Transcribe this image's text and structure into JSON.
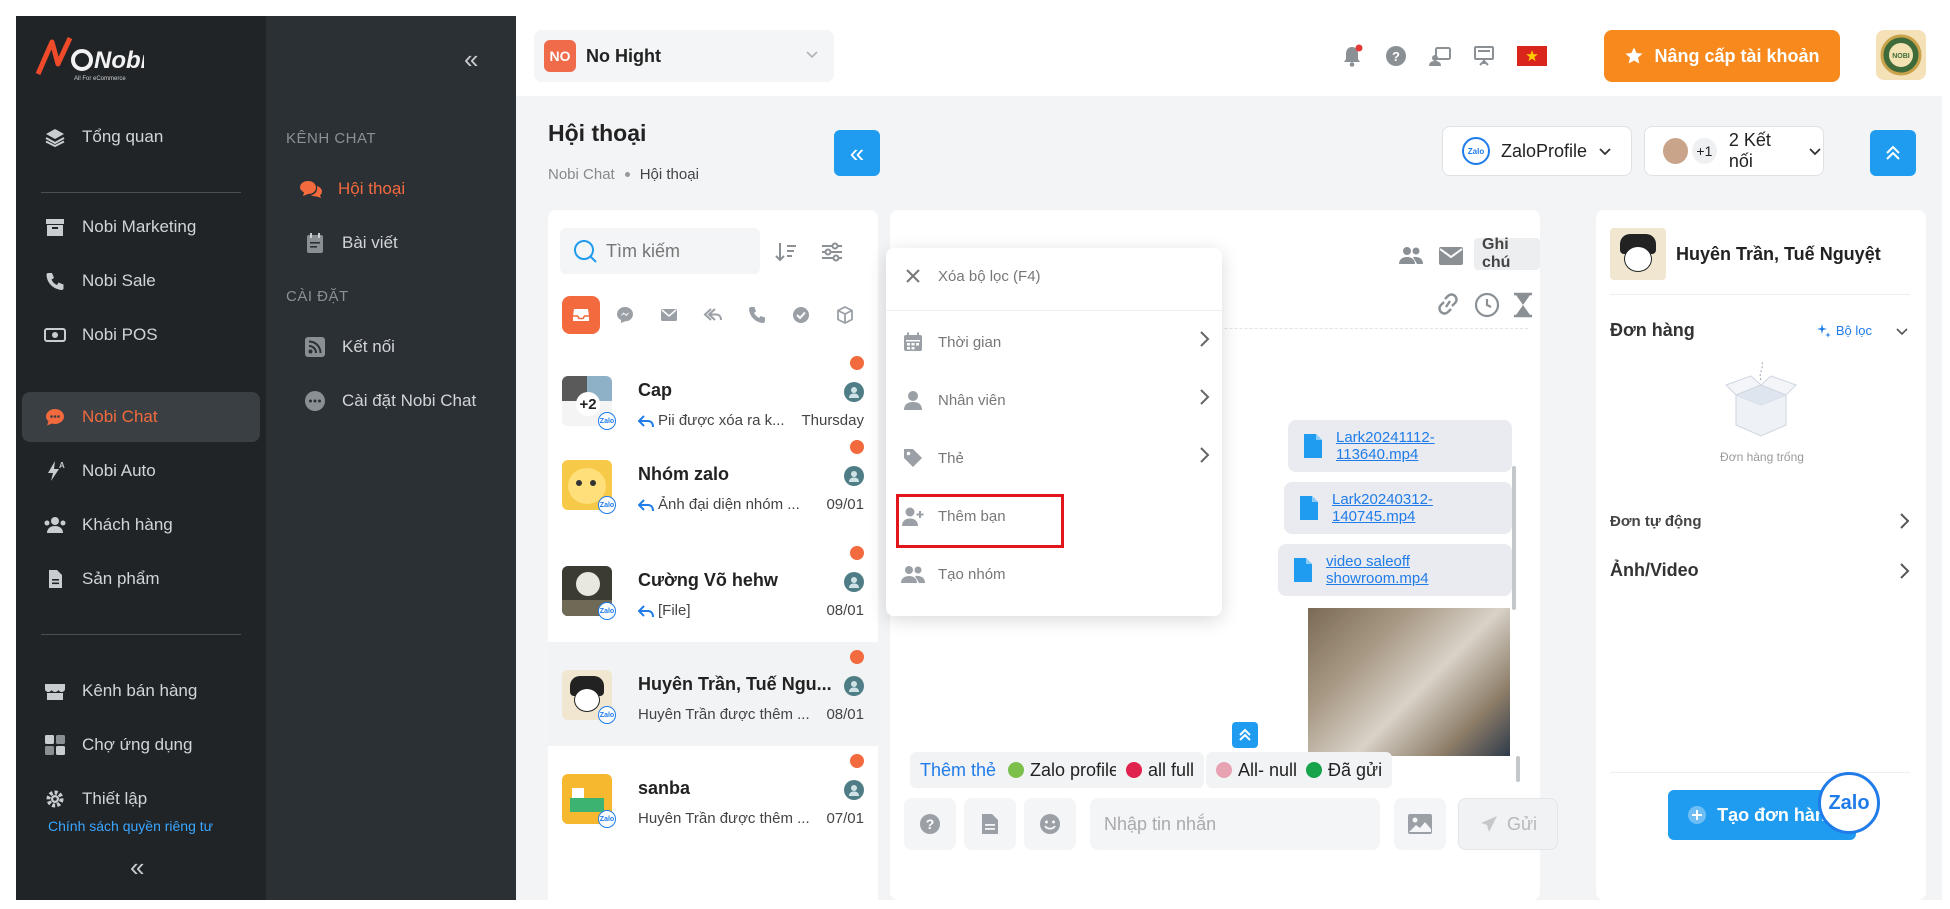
{
  "sidebar": {
    "brand_text": "Nobi",
    "tagline": "All For eCommerce",
    "items": [
      {
        "label": "Tổng quan",
        "icon": "layers-icon"
      },
      {
        "label": "Nobi Marketing",
        "icon": "archive-icon"
      },
      {
        "label": "Nobi Sale",
        "icon": "phone-call-icon"
      },
      {
        "label": "Nobi POS",
        "icon": "cash-icon"
      },
      {
        "label": "Nobi Chat",
        "icon": "chat-bubble-icon"
      },
      {
        "label": "Nobi Auto",
        "icon": "lightning-auto-icon"
      },
      {
        "label": "Khách hàng",
        "icon": "users-icon"
      },
      {
        "label": "Sản phẩm",
        "icon": "document-icon"
      },
      {
        "label": "Kênh bán hàng",
        "icon": "storefront-icon"
      },
      {
        "label": "Chợ ứng dụng",
        "icon": "app-grid-icon"
      },
      {
        "label": "Thiết lập",
        "icon": "gear-icon"
      }
    ],
    "policy_link": "Chính sách quyền riêng tư",
    "collapse_symbol": "«"
  },
  "subnav": {
    "collapse_symbol": "«",
    "sections": [
      {
        "title": "KÊNH CHAT",
        "items": [
          {
            "label": "Hội thoại"
          },
          {
            "label": "Bài viết"
          }
        ]
      },
      {
        "title": "CÀI ĐẶT",
        "items": [
          {
            "label": "Kết nối"
          },
          {
            "label": "Cài đặt Nobi Chat"
          }
        ]
      }
    ]
  },
  "topbar": {
    "shop_badge": "NO",
    "shop_name": "No Hight",
    "upgrade_label": "Nâng cấp tài khoản",
    "avatar_text": "NOBI"
  },
  "page": {
    "title": "Hội thoại",
    "breadcrumb": [
      "Nobi Chat",
      "Hội thoại"
    ],
    "collapse_symbol": "«",
    "channel_select": "ZaloProfile",
    "zalo_logo_text": "Zalo",
    "connections": {
      "extra": "+1",
      "label": "2 Kết nối"
    },
    "expand_symbol": "⌃"
  },
  "conversations": {
    "search_placeholder": "Tìm kiếm",
    "items": [
      {
        "name": "Cap",
        "message": "Pii được xóa ra k...",
        "time": "Thursday",
        "avatar_text": "+2",
        "replied": true
      },
      {
        "name": "Nhóm zalo",
        "message": "Ảnh đại diện nhóm ...",
        "time": "09/01",
        "avatar_text": "",
        "replied": true
      },
      {
        "name": "Cường Võ hehw",
        "message": "[File]",
        "time": "08/01",
        "avatar_text": "",
        "replied": true
      },
      {
        "name": "Huyên Trần, Tuế Ngu...",
        "message": "Huyên Trần được thêm ...",
        "time": "08/01",
        "avatar_text": "",
        "replied": false
      },
      {
        "name": "sanba",
        "message": "Huyên Trần được thêm ...",
        "time": "07/01",
        "avatar_text": "",
        "replied": false
      }
    ],
    "zalo_mini": "Zalo"
  },
  "chat": {
    "note_label": "Ghi chú",
    "files": [
      {
        "name": "Lark20241112-113640.mp4"
      },
      {
        "name": "Lark20240312-140745.mp4"
      },
      {
        "name": "video saleoff showroom.mp4"
      }
    ],
    "tags": [
      {
        "label": "Thêm thẻ",
        "color": ""
      },
      {
        "label": "Zalo profile",
        "color": "#7cc04b"
      },
      {
        "label": "all full",
        "color": "#e0234e"
      },
      {
        "label": "All- null",
        "color": "#e8a3b3"
      },
      {
        "label": "Đã gửi",
        "color": "#16a34a"
      }
    ],
    "input_placeholder": "Nhập tin nhắn",
    "send_label": "Gửi",
    "scroll_up_symbol": "⌃"
  },
  "filter_menu": {
    "items": [
      {
        "label": "Xóa bộ lọc (F4)",
        "icon": "close-icon",
        "has_arrow": false
      },
      {
        "label": "Thời gian",
        "icon": "calendar-icon",
        "has_arrow": true
      },
      {
        "label": "Nhân viên",
        "icon": "person-icon",
        "has_arrow": true
      },
      {
        "label": "Thẻ",
        "icon": "tag-icon",
        "has_arrow": true
      },
      {
        "label": "Thêm bạn",
        "icon": "add-friend-icon",
        "has_arrow": false
      },
      {
        "label": "Tạo nhóm",
        "icon": "group-icon",
        "has_arrow": false
      }
    ],
    "arrow_symbol": "›"
  },
  "customer": {
    "name": "Huyên Trần, Tuế Nguyệt",
    "orders_label": "Đơn hàng",
    "filter_label": "Bộ lọc",
    "empty_orders": "Đơn hàng trống",
    "auto_orders": "Đơn tự động",
    "media": "Ảnh/Video",
    "create_order": "Tạo đơn hàng",
    "arrow_symbol": "›",
    "zalo_float": "Zalo"
  },
  "colors": {
    "accent_orange": "#f26a3d",
    "primary_blue": "#1f9cf0",
    "upgrade_orange": "#f88a1d",
    "sidebar_dark": "#202427",
    "highlight_red": "#e2141c"
  }
}
